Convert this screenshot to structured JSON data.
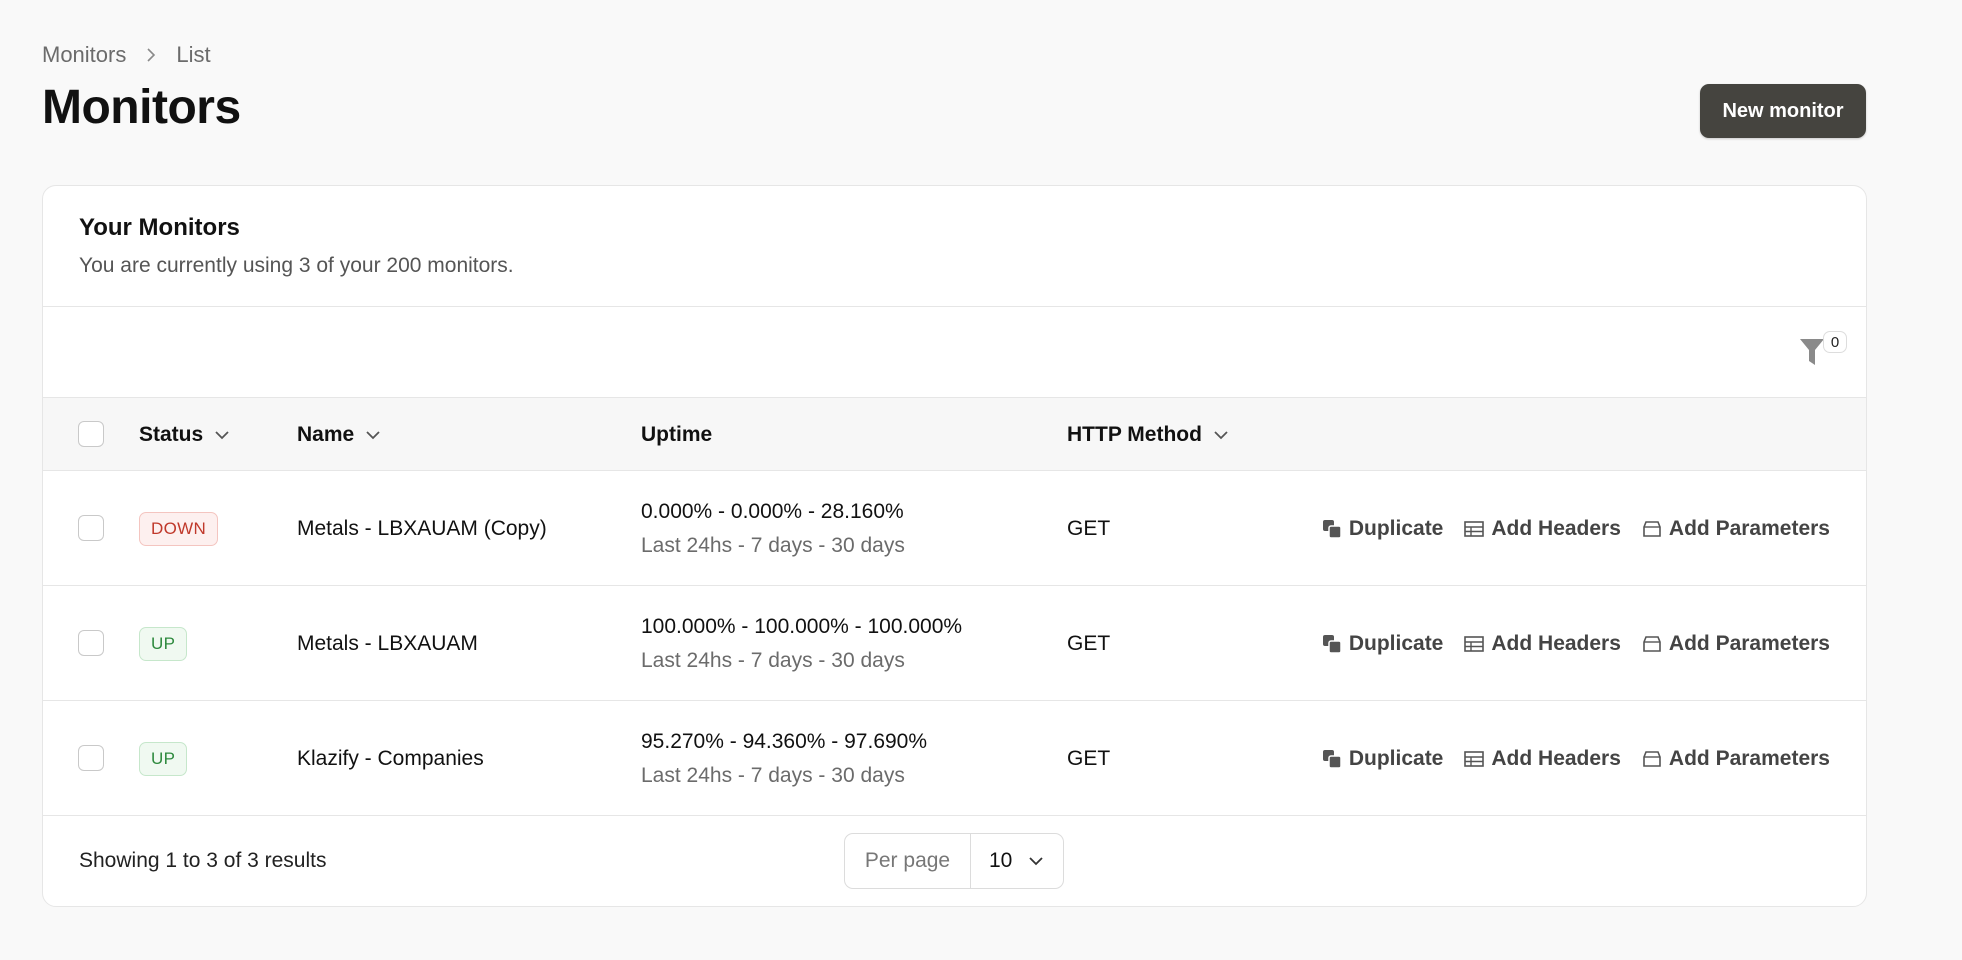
{
  "breadcrumb": {
    "items": [
      "Monitors",
      "List"
    ]
  },
  "page": {
    "title": "Monitors",
    "new_button": "New monitor"
  },
  "card": {
    "title": "Your Monitors",
    "subtitle": "You are currently using 3 of your 200 monitors."
  },
  "filter": {
    "count": "0",
    "icon": "funnel-icon"
  },
  "table": {
    "columns": [
      "Status",
      "Name",
      "Uptime",
      "HTTP Method"
    ],
    "rows": [
      {
        "status": "DOWN",
        "name": "Metals - LBXAUAM (Copy)",
        "uptime": "0.000% - 0.000% - 28.160%",
        "uptime_periods": "Last 24hs - 7 days - 30 days",
        "method": "GET"
      },
      {
        "status": "UP",
        "name": "Metals - LBXAUAM",
        "uptime": "100.000% - 100.000% - 100.000%",
        "uptime_periods": "Last 24hs - 7 days - 30 days",
        "method": "GET"
      },
      {
        "status": "UP",
        "name": "Klazify - Companies",
        "uptime": "95.270% - 94.360% - 97.690%",
        "uptime_periods": "Last 24hs - 7 days - 30 days",
        "method": "GET"
      }
    ],
    "actions": {
      "duplicate": "Duplicate",
      "add_headers": "Add Headers",
      "add_parameters": "Add Parameters"
    }
  },
  "footer": {
    "showing": "Showing 1 to 3 of 3 results",
    "per_page_label": "Per page",
    "per_page_value": "10"
  },
  "colors": {
    "primary_button": "#45443f",
    "down": "#c0392b",
    "up": "#2e8a3e"
  }
}
